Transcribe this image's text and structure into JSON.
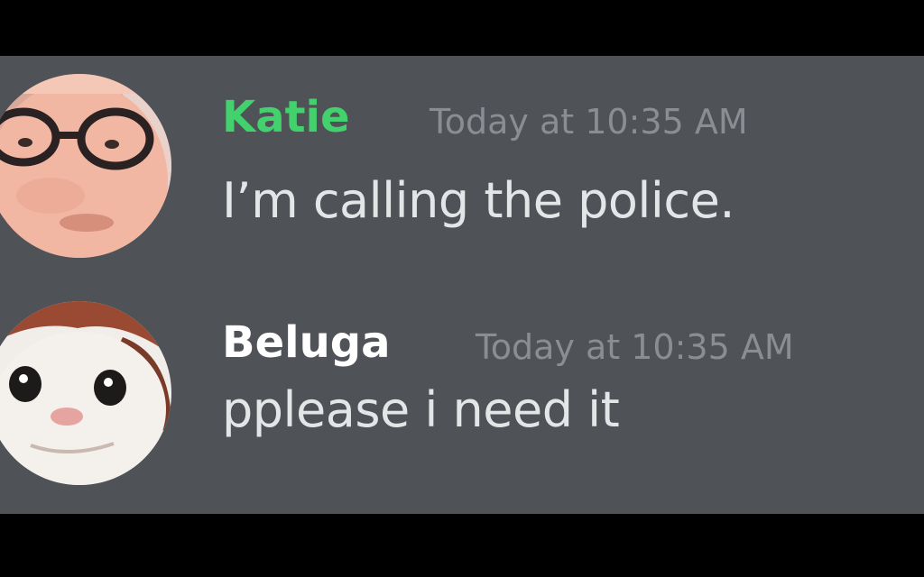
{
  "colors": {
    "background": "#000000",
    "chat_background": "#4f5257",
    "timestamp": "#8a8d92",
    "message_text": "#e4e5e7"
  },
  "messages": [
    {
      "author": "Katie",
      "author_color": "#43d16e",
      "timestamp": "Today at 10:35 AM",
      "text": "I’m calling the police.",
      "avatar": "person-with-glasses-avatar"
    },
    {
      "author": "Beluga",
      "author_color": "#ffffff",
      "timestamp": "Today at 10:35 AM",
      "text": "pplease i need it",
      "avatar": "cat-avatar"
    }
  ]
}
